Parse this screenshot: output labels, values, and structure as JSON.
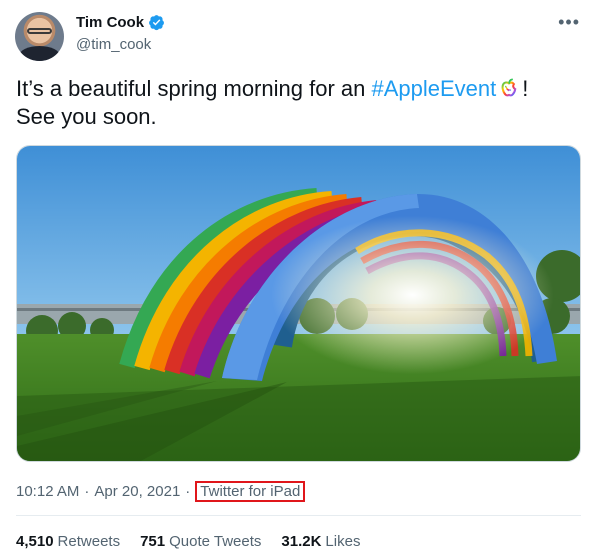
{
  "author": {
    "display_name": "Tim Cook",
    "handle": "@tim_cook"
  },
  "tweet": {
    "text_part1": "It’s a beautiful spring morning for an ",
    "hashtag": "#AppleEvent",
    "text_part2": "!",
    "text_line2": "See you soon."
  },
  "meta": {
    "time": "10:12 AM",
    "separator": "·",
    "date": "Apr 20, 2021",
    "source": "Twitter for iPad"
  },
  "stats": [
    {
      "count": "4,510",
      "label": "Retweets"
    },
    {
      "count": "751",
      "label": "Quote Tweets"
    },
    {
      "count": "31.2K",
      "label": "Likes"
    }
  ],
  "icons": {
    "verified": "verified-badge-icon",
    "more": "more-options-icon",
    "apple_event": "apple-logo-emoji-icon"
  },
  "colors": {
    "link": "#1d9bf0",
    "highlight_box": "#e0161b",
    "secondary_text": "#536471"
  }
}
